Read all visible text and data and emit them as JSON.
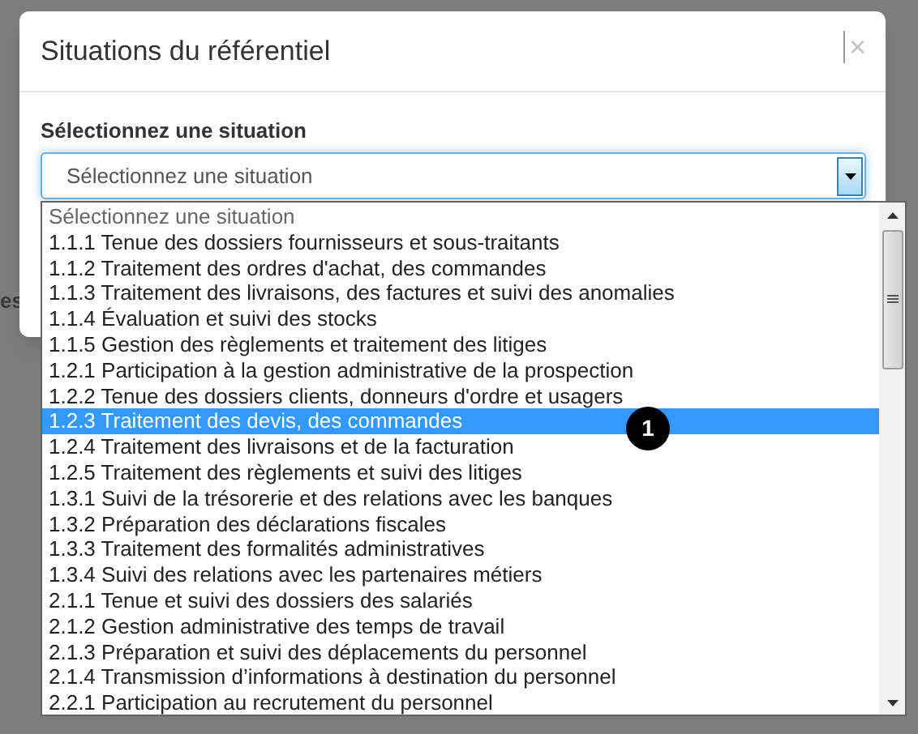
{
  "background_fragment": "es",
  "dialog": {
    "title": "Situations du référentiel",
    "close": "×",
    "field_label": "Sélectionnez une situation",
    "select_value": "Sélectionnez une situation",
    "options": [
      {
        "kind": "placeholder",
        "label": "Sélectionnez une situation",
        "selected": false
      },
      {
        "kind": "option",
        "label": "1.1.1 Tenue des dossiers fournisseurs et sous-traitants",
        "selected": false
      },
      {
        "kind": "option",
        "label": "1.1.2 Traitement des ordres d'achat, des commandes",
        "selected": false
      },
      {
        "kind": "option",
        "label": "1.1.3 Traitement des livraisons, des factures et suivi des anomalies",
        "selected": false
      },
      {
        "kind": "option",
        "label": "1.1.4 Évaluation et suivi des stocks",
        "selected": false
      },
      {
        "kind": "option",
        "label": "1.1.5 Gestion des règlements et traitement des litiges",
        "selected": false
      },
      {
        "kind": "option",
        "label": "1.2.1 Participation à la gestion administrative de la prospection",
        "selected": false
      },
      {
        "kind": "option",
        "label": "1.2.2 Tenue des dossiers clients, donneurs d'ordre et usagers",
        "selected": false
      },
      {
        "kind": "option",
        "label": "1.2.3 Traitement des devis, des commandes",
        "selected": true
      },
      {
        "kind": "option",
        "label": "1.2.4 Traitement des livraisons et de la facturation",
        "selected": false
      },
      {
        "kind": "option",
        "label": "1.2.5 Traitement des règlements et suivi des litiges",
        "selected": false
      },
      {
        "kind": "option",
        "label": "1.3.1 Suivi de la trésorerie et des relations avec les banques",
        "selected": false
      },
      {
        "kind": "option",
        "label": "1.3.2 Préparation des déclarations fiscales",
        "selected": false
      },
      {
        "kind": "option",
        "label": "1.3.3 Traitement des formalités administratives",
        "selected": false
      },
      {
        "kind": "option",
        "label": "1.3.4 Suivi des relations avec les partenaires métiers",
        "selected": false
      },
      {
        "kind": "option",
        "label": "2.1.1 Tenue et suivi des dossiers des salariés",
        "selected": false
      },
      {
        "kind": "option",
        "label": "2.1.2 Gestion administrative des temps de travail",
        "selected": false
      },
      {
        "kind": "option",
        "label": "2.1.3 Préparation et suivi des déplacements du personnel",
        "selected": false
      },
      {
        "kind": "option",
        "label": "2.1.4 Transmission d’informations à destination du personnel",
        "selected": false
      },
      {
        "kind": "option",
        "label": "2.2.1 Participation au recrutement du personnel",
        "selected": false
      }
    ]
  },
  "callout": "1"
}
